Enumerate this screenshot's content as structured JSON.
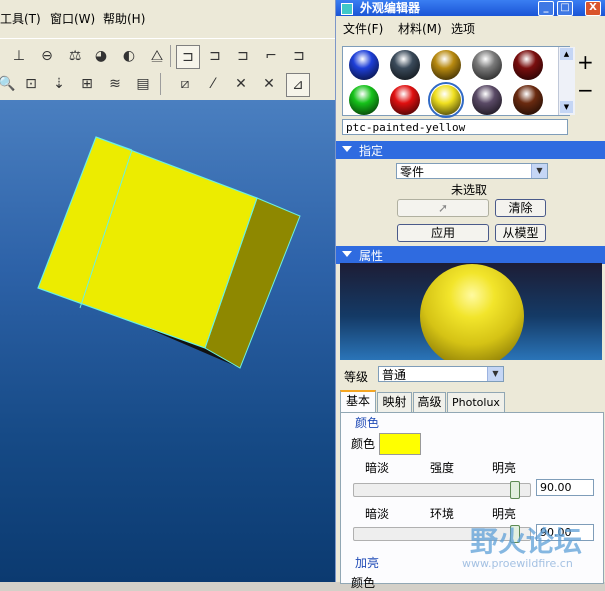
{
  "left_menu": {
    "tools": "工具(T)",
    "window": "窗口(W)",
    "help": "帮助(H)"
  },
  "panel": {
    "title": "外观编辑器",
    "window_buttons": {
      "minimize": "_",
      "restore": "□",
      "close": "X"
    },
    "menu": {
      "file": "文件(F)",
      "materials": "材料(M)",
      "options": "选项"
    },
    "swatches": [
      {
        "name": "blue",
        "color": "#1e3fd8"
      },
      {
        "name": "dark-gray",
        "color": "#3a4a5a"
      },
      {
        "name": "gold",
        "color": "#b88a10"
      },
      {
        "name": "gray",
        "color": "#7a7a7a"
      },
      {
        "name": "dark-red",
        "color": "#7a0e0e"
      },
      {
        "name": "green",
        "color": "#16c21a"
      },
      {
        "name": "red",
        "color": "#e01010"
      },
      {
        "name": "yellow",
        "color": "#f0e020"
      },
      {
        "name": "purple-gray",
        "color": "#5a4a66"
      },
      {
        "name": "brown",
        "color": "#6a2a10"
      }
    ],
    "selected_swatch": "yellow",
    "add_label": "+",
    "remove_label": "−",
    "material_name": "ptc-painted-yellow"
  },
  "assign": {
    "header": "指定",
    "target_value": "零件",
    "selection_status": "未选取",
    "clear_label": "清除",
    "apply_label": "应用",
    "from_model_label": "从模型"
  },
  "properties": {
    "header": "属性",
    "grade_label": "等级",
    "grade_value": "普通",
    "tabs": [
      "基本",
      "映射",
      "高级",
      "Photolux"
    ],
    "active_tab": "基本",
    "color_group": "颜色",
    "color_label": "颜色",
    "color_swatch": "#ffff00",
    "slider1": {
      "left": "暗淡",
      "mid": "强度",
      "right": "明亮",
      "value": "90.00"
    },
    "slider2": {
      "left": "暗淡",
      "mid": "环境",
      "right": "明亮",
      "value": "90.00"
    },
    "highlight_group": "加亮",
    "highlight_color_label": "颜色"
  },
  "colors": {
    "title_bar": "#1a54d6",
    "section_header": "#2f6be0",
    "cube": "#f2f200",
    "viewport": "#164a86"
  },
  "watermark": {
    "text": "野火论坛",
    "url": "www.proewildfire.cn"
  }
}
